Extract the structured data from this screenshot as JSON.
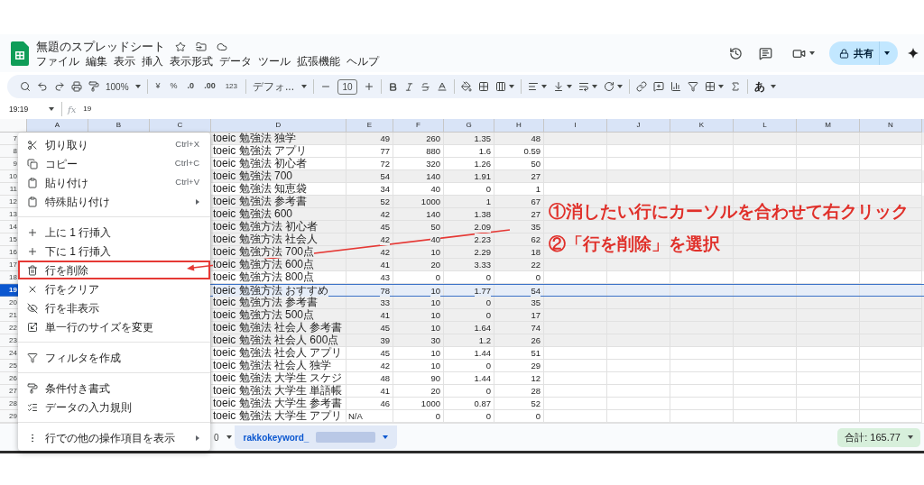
{
  "window": {
    "title": "無題のスプレッドシート",
    "share": "共有"
  },
  "menu_bar": [
    "ファイル",
    "編集",
    "表示",
    "挿入",
    "表示形式",
    "データ",
    "ツール",
    "拡張機能",
    "ヘルプ"
  ],
  "toolbar": {
    "zoom": "100%",
    "currency": "¥",
    "percent": "%",
    "decimal_decrease": ".0",
    "decimal_increase": ".00",
    "number_format": "123",
    "font": "デフォ...",
    "font_size": "10",
    "input_tool": "あ"
  },
  "formula_bar": {
    "name_box": "19:19",
    "fx": "fx",
    "value": "19"
  },
  "columns": [
    "A",
    "B",
    "C",
    "D",
    "E",
    "F",
    "G",
    "H",
    "I",
    "J",
    "K",
    "L",
    "M",
    "N"
  ],
  "rows": [
    {
      "number": "7",
      "shaded": true,
      "selected": false,
      "cells": [
        "toeic 勉強法 独学",
        "49",
        "260",
        "1.35",
        "48"
      ]
    },
    {
      "number": "8",
      "shaded": false,
      "selected": false,
      "cells": [
        "toeic 勉強法 アプリ",
        "77",
        "880",
        "1.6",
        "0.59"
      ]
    },
    {
      "number": "9",
      "shaded": false,
      "selected": false,
      "cells": [
        "toeic 勉強法 初心者",
        "72",
        "320",
        "1.26",
        "50"
      ]
    },
    {
      "number": "10",
      "shaded": true,
      "selected": false,
      "cells": [
        "toeic 勉強法 700",
        "54",
        "140",
        "1.91",
        "27"
      ]
    },
    {
      "number": "11",
      "shaded": false,
      "selected": false,
      "cells": [
        "toeic 勉強法 知恵袋",
        "34",
        "40",
        "0",
        "1"
      ]
    },
    {
      "number": "12",
      "shaded": true,
      "selected": false,
      "cells": [
        "toeic 勉強法 参考書",
        "52",
        "1000",
        "1",
        "67"
      ]
    },
    {
      "number": "13",
      "shaded": true,
      "selected": false,
      "cells": [
        "toeic 勉強法 600",
        "42",
        "140",
        "1.38",
        "27"
      ]
    },
    {
      "number": "14",
      "shaded": true,
      "selected": false,
      "cells": [
        "toeic 勉強方法 初心者",
        "45",
        "50",
        "2.09",
        "35"
      ]
    },
    {
      "number": "15",
      "shaded": true,
      "selected": false,
      "cells": [
        "toeic 勉強方法 社会人",
        "42",
        "40",
        "2.23",
        "62"
      ]
    },
    {
      "number": "16",
      "shaded": true,
      "selected": false,
      "cells": [
        "toeic 勉強方法 700点",
        "42",
        "10",
        "2.29",
        "18"
      ]
    },
    {
      "number": "17",
      "shaded": true,
      "selected": false,
      "cells": [
        "toeic 勉強方法 600点",
        "41",
        "20",
        "3.33",
        "22"
      ]
    },
    {
      "number": "18",
      "shaded": false,
      "selected": false,
      "cells": [
        "toeic 勉強方法 800点",
        "43",
        "0",
        "0",
        "0"
      ]
    },
    {
      "number": "19",
      "shaded": false,
      "selected": true,
      "cells": [
        "toeic 勉強方法 おすすめ",
        "78",
        "10",
        "1.77",
        "54"
      ]
    },
    {
      "number": "20",
      "shaded": true,
      "selected": false,
      "cells": [
        "toeic 勉強方法 参考書",
        "33",
        "10",
        "0",
        "35"
      ]
    },
    {
      "number": "21",
      "shaded": true,
      "selected": false,
      "cells": [
        "toeic 勉強方法 500点",
        "41",
        "10",
        "0",
        "17"
      ]
    },
    {
      "number": "22",
      "shaded": true,
      "selected": false,
      "cells": [
        "toeic 勉強法 社会人 参考書",
        "45",
        "10",
        "1.64",
        "74"
      ]
    },
    {
      "number": "23",
      "shaded": true,
      "selected": false,
      "cells": [
        "toeic 勉強法 社会人 600点",
        "39",
        "30",
        "1.2",
        "26"
      ]
    },
    {
      "number": "24",
      "shaded": false,
      "selected": false,
      "cells": [
        "toeic 勉強法 社会人 アプリ",
        "45",
        "10",
        "1.44",
        "51"
      ]
    },
    {
      "number": "25",
      "shaded": false,
      "selected": false,
      "cells": [
        "toeic 勉強法 社会人 独学",
        "42",
        "10",
        "0",
        "29"
      ]
    },
    {
      "number": "26",
      "shaded": false,
      "selected": false,
      "cells": [
        "toeic 勉強法 大学生 スケジ",
        "48",
        "90",
        "1.44",
        "12"
      ]
    },
    {
      "number": "27",
      "shaded": false,
      "selected": false,
      "cells": [
        "toeic 勉強法 大学生 単語帳",
        "41",
        "20",
        "0",
        "28"
      ]
    },
    {
      "number": "28",
      "shaded": false,
      "selected": false,
      "cells": [
        "toeic 勉強法 大学生 参考書",
        "46",
        "1000",
        "0.87",
        "52"
      ]
    },
    {
      "number": "29",
      "shaded": false,
      "selected": false,
      "cells": [
        "toeic 勉強法 大学生 アプリ",
        {
          "text": "N/A",
          "kind": "error"
        },
        "0",
        "0",
        "0"
      ]
    }
  ],
  "context_menu": {
    "items": [
      {
        "kind": "item",
        "label": "切り取り",
        "shortcut": "Ctrl+X",
        "submenu": false,
        "highlighted": false
      },
      {
        "kind": "item",
        "label": "コピー",
        "shortcut": "Ctrl+C",
        "submenu": false,
        "highlighted": false
      },
      {
        "kind": "item",
        "label": "貼り付け",
        "shortcut": "Ctrl+V",
        "submenu": false,
        "highlighted": false
      },
      {
        "kind": "item",
        "label": "特殊貼り付け",
        "submenu": true,
        "highlighted": false
      },
      {
        "kind": "divider"
      },
      {
        "kind": "item",
        "label": "上に 1 行挿入",
        "submenu": false,
        "highlighted": false
      },
      {
        "kind": "item",
        "label": "下に 1 行挿入",
        "submenu": false,
        "highlighted": false
      },
      {
        "kind": "item",
        "label": "行を削除",
        "submenu": false,
        "highlighted": true
      },
      {
        "kind": "item",
        "label": "行をクリア",
        "submenu": false,
        "highlighted": false
      },
      {
        "kind": "item",
        "label": "行を非表示",
        "submenu": false,
        "highlighted": false
      },
      {
        "kind": "item",
        "label": "単一行のサイズを変更",
        "submenu": false,
        "highlighted": false
      },
      {
        "kind": "divider"
      },
      {
        "kind": "item",
        "label": "フィルタを作成",
        "submenu": false,
        "highlighted": false
      },
      {
        "kind": "divider"
      },
      {
        "kind": "item",
        "label": "条件付き書式",
        "submenu": false,
        "highlighted": false
      },
      {
        "kind": "item",
        "label": "データの入力規則",
        "submenu": false,
        "highlighted": false
      },
      {
        "kind": "divider"
      },
      {
        "kind": "item",
        "label": "行での他の操作項目を表示",
        "submenu": true,
        "highlighted": false
      }
    ]
  },
  "annotation": {
    "steps": [
      "①消したい行にカーソルを合わせて右クリック",
      "②「行を削除」を選択"
    ]
  },
  "sheet_bar": {
    "tabs": [
      {
        "label": "0",
        "selected": false,
        "redacted": false
      },
      {
        "label": "rakkokeyword_",
        "selected": true,
        "redacted": true
      }
    ],
    "summary": "合計: 165.77"
  }
}
